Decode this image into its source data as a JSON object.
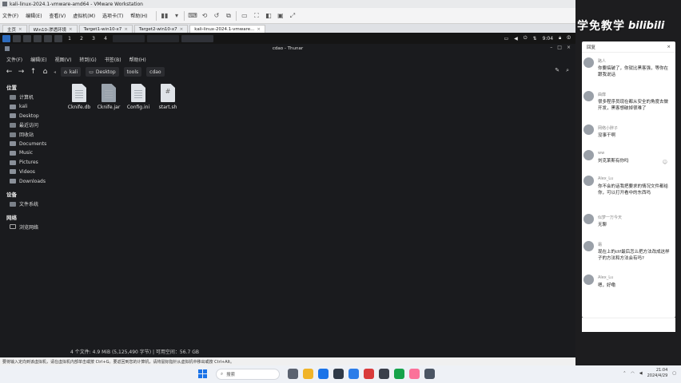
{
  "vmware": {
    "title": "kali-linux-2024.1-vmware-amd64 - VMware Workstation",
    "menu": [
      "文件(F)",
      "编辑(E)",
      "查看(V)",
      "虚拟机(M)",
      "选项卡(T)",
      "帮助(H)"
    ],
    "tabs": [
      {
        "label": "主页"
      },
      {
        "label": "Win10-渗透环境"
      },
      {
        "label": "Target1-win10-x7"
      },
      {
        "label": "Target2-win10-x7"
      },
      {
        "label": "kali-linux-2024.1-vmware..."
      }
    ],
    "status_text": "要将输入定向到该虚拟机，请在虚拟机内部单击或按 Ctrl+G。要返回到您的计算机，请将鼠标指针从虚拟机中移出或按 Ctrl+Alt。"
  },
  "kali_panel": {
    "workspaces": [
      "1",
      "2",
      "3",
      "4"
    ],
    "time": "9:04"
  },
  "thunar": {
    "window_title": "cdao - Thunar",
    "menu": [
      "文件(F)",
      "编辑(E)",
      "视图(V)",
      "转到(G)",
      "书签(B)",
      "帮助(H)"
    ],
    "breadcrumbs": [
      "kali",
      "Desktop",
      "tools",
      "cdao"
    ],
    "sidebar": {
      "places_header": "位置",
      "places": [
        "计算机",
        "kali",
        "Desktop",
        "最近访问",
        "回收站",
        "Documents",
        "Music",
        "Pictures",
        "Videos",
        "Downloads"
      ],
      "devices_header": "设备",
      "devices": [
        "文件系统"
      ],
      "network_header": "网络",
      "network": [
        "浏览网络"
      ]
    },
    "files": [
      {
        "name": "Cknife.db",
        "kind": "doc"
      },
      {
        "name": "Cknife.jar",
        "kind": "jar"
      },
      {
        "name": "Config.ini",
        "kind": "doc"
      },
      {
        "name": "start.sh",
        "kind": "script"
      }
    ],
    "status": "4 个文件: 4.9 MiB (5,125,490 字节) | 可用空间：56.7 GB"
  },
  "taskbar": {
    "search_placeholder": "搜索",
    "time": "21:04",
    "date": "2024/4/29"
  },
  "panel": {
    "banner": "学免教学",
    "logo": "bilibili",
    "header_left": "回复",
    "header_right": "",
    "comments": [
      {
        "who": "路人",
        "text": "你要搞破了，你就比黑客强，等你在跟我说话"
      },
      {
        "who": "曲靡",
        "text": "很多程序员现在都从安全的角度去做开发，黑客想破掉很难了"
      },
      {
        "who": "网络小胖子",
        "text": "没事干啊"
      },
      {
        "who": "ww",
        "text": "刘克莱斯有你吗"
      },
      {
        "who": "Alex_Lu",
        "text": "你不会的话我把要求的情况文件都给你，可以打开看中的东西吗"
      },
      {
        "who": "似梦一万今天",
        "text": "无聊"
      },
      {
        "who": "霜",
        "text": "现在上的ctf最后怎么把方法改成这样子的方法和方法会有吗?"
      },
      {
        "who": "Alex_Lu",
        "text": "嗯，好嘞"
      }
    ]
  },
  "colors": {
    "kali_bg": "#1a1b1e",
    "accent": "#1a73e8",
    "panel_bg": "#1d1d1f"
  }
}
